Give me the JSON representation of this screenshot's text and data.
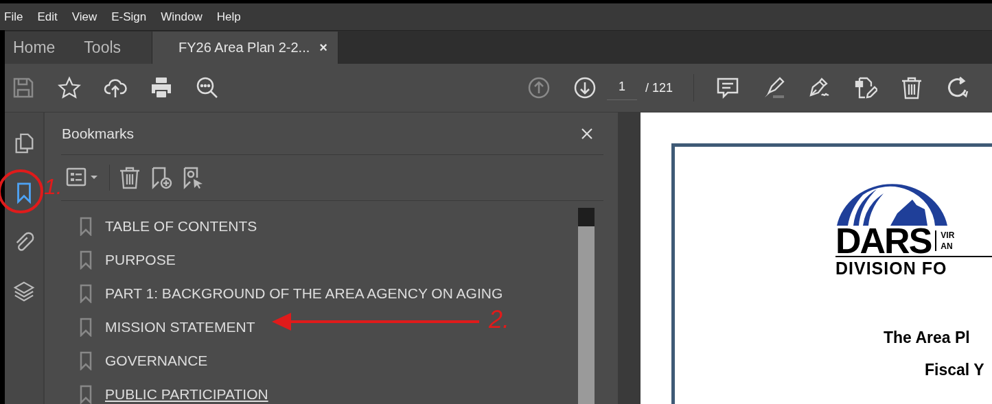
{
  "menu": [
    "File",
    "Edit",
    "View",
    "E-Sign",
    "Window",
    "Help"
  ],
  "tabs": [
    {
      "label": "Home",
      "selected": false
    },
    {
      "label": "Tools",
      "selected": false
    },
    {
      "label": "FY26 Area Plan 2-2...",
      "selected": true,
      "close": "×"
    }
  ],
  "toolbar": {
    "left": [
      {
        "kind": "save",
        "disabled": true
      },
      {
        "kind": "star",
        "disabled": false
      },
      {
        "kind": "upload",
        "disabled": false
      },
      {
        "kind": "print",
        "disabled": false
      },
      {
        "kind": "zoom",
        "disabled": false
      }
    ],
    "nav": [
      {
        "kind": "up",
        "disabled": true
      },
      {
        "kind": "down",
        "disabled": false
      }
    ],
    "page_field": {
      "value": "1"
    },
    "page_total": "/ 121",
    "right": [
      {
        "kind": "comment",
        "disabled": false
      },
      {
        "kind": "highlight",
        "disabled": false
      },
      {
        "kind": "sign",
        "disabled": false
      },
      {
        "kind": "edit",
        "disabled": false
      },
      {
        "kind": "trash",
        "disabled": false
      },
      {
        "kind": "rotate",
        "disabled": false
      }
    ]
  },
  "rail": [
    {
      "kind": "pages",
      "selected": false
    },
    {
      "kind": "bookmark",
      "selected": true
    },
    {
      "kind": "attachment",
      "selected": false
    },
    {
      "kind": "layers",
      "selected": false
    }
  ],
  "bookmarks": {
    "title": "Bookmarks",
    "items": [
      {
        "label": "TABLE OF CONTENTS",
        "hovered": false
      },
      {
        "label": "PURPOSE",
        "hovered": false
      },
      {
        "label": "PART 1: BACKGROUND OF THE AREA AGENCY ON AGING",
        "hovered": false
      },
      {
        "label": "MISSION STATEMENT",
        "hovered": false
      },
      {
        "label": "GOVERNANCE",
        "hovered": false
      },
      {
        "label": "PUBLIC PARTICIPATION",
        "hovered": true
      }
    ]
  },
  "document": {
    "logo_word": "DARS",
    "logo_side": [
      "VIR",
      "AN"
    ],
    "logo_division": "DIVISION FO",
    "lines": [
      "The Area Pl",
      "Fiscal Y"
    ]
  },
  "annotations": [
    "1.",
    "2."
  ]
}
